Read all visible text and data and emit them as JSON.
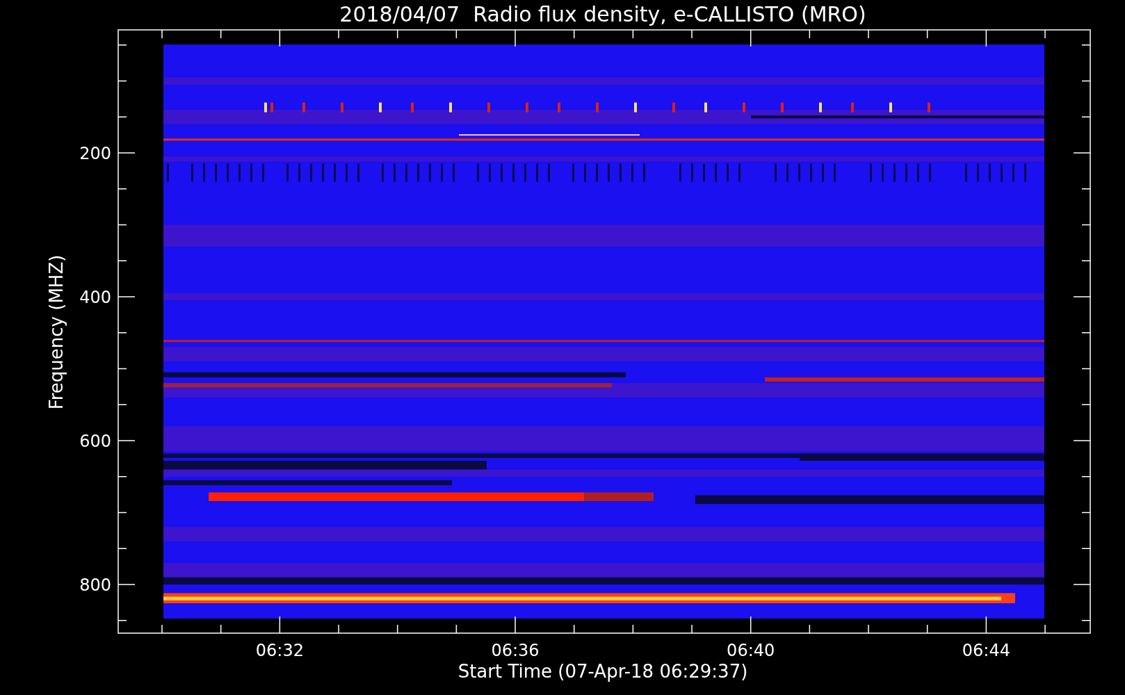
{
  "title": "2018/04/07  Radio flux density, e-CALLISTO (MRO)",
  "y_axis": {
    "label": "Frequency (MHZ)",
    "ticks": [
      "200",
      "400",
      "600",
      "800"
    ]
  },
  "x_axis": {
    "label": "Start Time (07-Apr-18 06:29:37)",
    "ticks": [
      "06:32",
      "06:36",
      "06:40",
      "06:44"
    ]
  }
}
